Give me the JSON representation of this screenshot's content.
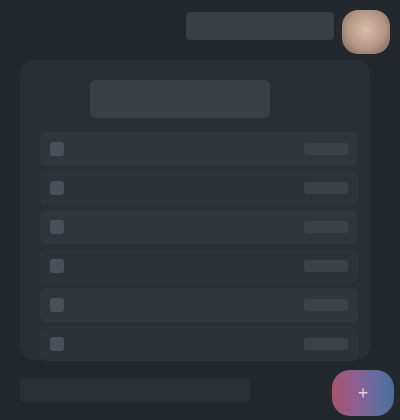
{
  "topbar": {
    "title": ""
  },
  "list": {
    "header": "",
    "items": [
      {
        "label": "",
        "value": ""
      },
      {
        "label": "",
        "value": ""
      },
      {
        "label": "",
        "value": ""
      },
      {
        "label": "",
        "value": ""
      },
      {
        "label": "",
        "value": ""
      },
      {
        "label": "",
        "value": ""
      }
    ]
  },
  "bottombar": {
    "text": ""
  },
  "fab": {
    "icon": "add-icon"
  },
  "colors": {
    "background": "#23272e",
    "panel": "#2a2e35",
    "avatar": "#c7a996",
    "fab_start": "#a4566c",
    "fab_end": "#4d6c94"
  }
}
